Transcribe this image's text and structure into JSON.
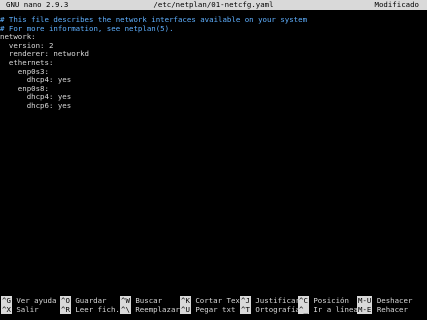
{
  "titlebar": {
    "app": "GNU nano 2.9.3",
    "filename": "/etc/netplan/01-netcfg.yaml",
    "status": "Modificado"
  },
  "editor": {
    "lines": [
      {
        "text": "# This file describes the network interfaces available on your system",
        "type": "comment"
      },
      {
        "text": "# For more information, see netplan(5).",
        "type": "comment"
      },
      {
        "text": "network:",
        "type": "code"
      },
      {
        "text": "  version: 2",
        "type": "code"
      },
      {
        "text": "  renderer: networkd",
        "type": "code"
      },
      {
        "text": "  ethernets:",
        "type": "code"
      },
      {
        "text": "    enp0s3:",
        "type": "code"
      },
      {
        "text": "      dhcp4: yes",
        "type": "code"
      },
      {
        "text": "    enp0s8:",
        "type": "code"
      },
      {
        "text": "      dhcp4: yes",
        "type": "code"
      },
      {
        "text": "      dhcp6: yes",
        "type": "code"
      }
    ]
  },
  "shortcuts": {
    "row1": [
      {
        "key": "^G",
        "label": "Ver ayuda"
      },
      {
        "key": "^O",
        "label": "Guardar"
      },
      {
        "key": "^W",
        "label": "Buscar"
      },
      {
        "key": "^K",
        "label": "Cortar Text"
      },
      {
        "key": "^J",
        "label": "Justificar"
      },
      {
        "key": "^C",
        "label": "Posición"
      },
      {
        "key": "M-U",
        "label": "Deshacer"
      }
    ],
    "row2": [
      {
        "key": "^X",
        "label": "Salir"
      },
      {
        "key": "^R",
        "label": "Leer fich."
      },
      {
        "key": "^\\",
        "label": "Reemplazar"
      },
      {
        "key": "^U",
        "label": "Pegar txt"
      },
      {
        "key": "^T",
        "label": "Ortografía"
      },
      {
        "key": "^_",
        "label": "Ir a línea"
      },
      {
        "key": "M-E",
        "label": "Rehacer"
      }
    ]
  },
  "colors": {
    "background": "#000000",
    "text": "#d8d8d8",
    "comment": "#5fb0ff",
    "bar": "#d9d9d9"
  }
}
